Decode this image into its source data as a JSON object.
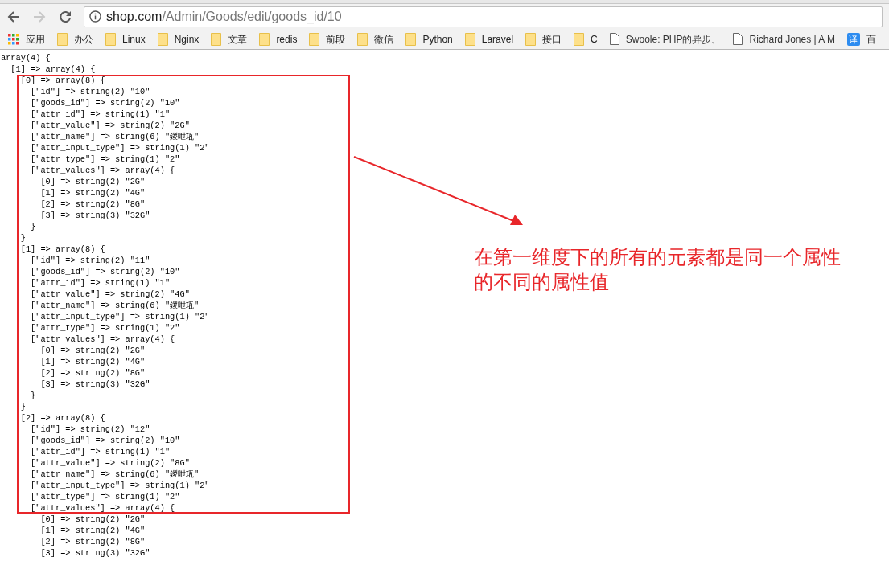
{
  "toolbar": {
    "nav": [
      {
        "kind": "back",
        "disabled": false
      },
      {
        "kind": "forward",
        "disabled": true
      },
      {
        "kind": "reload",
        "disabled": false
      }
    ],
    "address": {
      "host": "shop.com",
      "path": "/Admin/Goods/edit/goods_id/10"
    }
  },
  "bookmarks": [
    {
      "kind": "apps",
      "label": "应用"
    },
    {
      "kind": "folder",
      "label": "办公"
    },
    {
      "kind": "folder",
      "label": "Linux"
    },
    {
      "kind": "folder",
      "label": "Nginx"
    },
    {
      "kind": "folder",
      "label": "文章"
    },
    {
      "kind": "folder",
      "label": "redis"
    },
    {
      "kind": "folder",
      "label": "前段"
    },
    {
      "kind": "folder",
      "label": "微信"
    },
    {
      "kind": "folder",
      "label": "Python"
    },
    {
      "kind": "folder",
      "label": "Laravel"
    },
    {
      "kind": "folder",
      "label": "接口"
    },
    {
      "kind": "folder",
      "label": "C"
    },
    {
      "kind": "page",
      "label": "Swoole: PHP的异步、"
    },
    {
      "kind": "page",
      "label": "Richard Jones | A M"
    },
    {
      "kind": "translate",
      "icon": "译",
      "label": "百"
    }
  ],
  "dump": {
    "before": [
      "array(4) {",
      "  [1] => array(4) {"
    ],
    "highlighted": [
      "    [0] => array(8) {",
      "      [\"id\"] => string(2) \"10\"",
      "      [\"goods_id\"] => string(2) \"10\"",
      "      [\"attr_id\"] => string(1) \"1\"",
      "      [\"attr_value\"] => string(2) \"2G\"",
      "      [\"attr_name\"] => string(6) \"鍐呭瓨\"",
      "      [\"attr_input_type\"] => string(1) \"2\"",
      "      [\"attr_type\"] => string(1) \"2\"",
      "      [\"attr_values\"] => array(4) {",
      "        [0] => string(2) \"2G\"",
      "        [1] => string(2) \"4G\"",
      "        [2] => string(2) \"8G\"",
      "        [3] => string(3) \"32G\"",
      "      }",
      "    }",
      "    [1] => array(8) {",
      "      [\"id\"] => string(2) \"11\"",
      "      [\"goods_id\"] => string(2) \"10\"",
      "      [\"attr_id\"] => string(1) \"1\"",
      "      [\"attr_value\"] => string(2) \"4G\"",
      "      [\"attr_name\"] => string(6) \"鍐呭瓨\"",
      "      [\"attr_input_type\"] => string(1) \"2\"",
      "      [\"attr_type\"] => string(1) \"2\"",
      "      [\"attr_values\"] => array(4) {",
      "        [0] => string(2) \"2G\"",
      "        [1] => string(2) \"4G\"",
      "        [2] => string(2) \"8G\"",
      "        [3] => string(3) \"32G\"",
      "      }",
      "    }",
      "    [2] => array(8) {",
      "      [\"id\"] => string(2) \"12\"",
      "      [\"goods_id\"] => string(2) \"10\"",
      "      [\"attr_id\"] => string(1) \"1\"",
      "      [\"attr_value\"] => string(2) \"8G\"",
      "      [\"attr_name\"] => string(6) \"鍐呭瓨\"",
      "      [\"attr_input_type\"] => string(1) \"2\"",
      "      [\"attr_type\"] => string(1) \"2\"",
      "      [\"attr_values\"] => array(4) {"
    ],
    "after": [
      "        [0] => string(2) \"2G\"",
      "        [1] => string(2) \"4G\"",
      "        [2] => string(2) \"8G\"",
      "        [3] => string(3) \"32G\""
    ]
  },
  "annotation": {
    "text": "在第一维度下的所有的元素都是同一个属性的不同的属性值"
  }
}
